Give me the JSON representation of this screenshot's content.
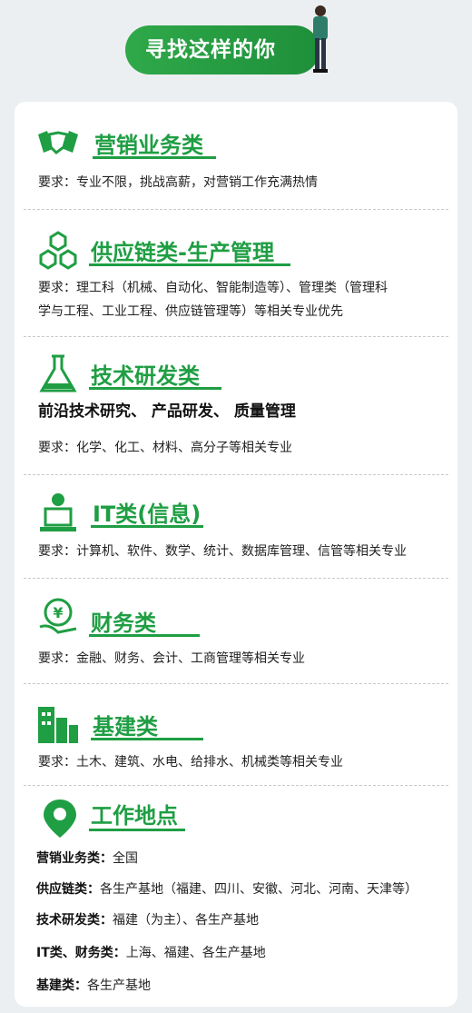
{
  "banner": {
    "title": "寻找这样的你"
  },
  "sections": [
    {
      "title": "营销业务类",
      "requirement": "要求：专业不限，挑战高薪，对营销工作充满热情",
      "icon": "handshake-icon"
    },
    {
      "title": "供应链类-生产管理",
      "requirement_line1": "要求：理工科（机械、自动化、智能制造等）、管理类（管理科",
      "requirement_line2": "学与工程、工业工程、供应链管理等）等相关专业优先",
      "icon": "cubes-icon"
    },
    {
      "title": "技术研发类",
      "focus": "前沿技术研究、 产品研发、 质量管理",
      "requirement": "要求：化学、化工、材料、高分子等相关专业",
      "icon": "flask-icon"
    },
    {
      "title": "IT类(信息)",
      "requirement": "要求：计算机、软件、数学、统计、数据库管理、信管等相关专业",
      "icon": "computer-user-icon"
    },
    {
      "title": "财务类",
      "requirement": "要求：金融、财务、会计、工商管理等相关专业",
      "icon": "yen-hand-icon"
    },
    {
      "title": "基建类",
      "requirement": "要求：土木、建筑、水电、给排水、机械类等相关专业",
      "icon": "buildings-icon"
    },
    {
      "title": "工作地点",
      "icon": "location-pin-icon"
    }
  ],
  "locations": [
    {
      "label": "营销业务类：",
      "value": "全国"
    },
    {
      "label": "供应链类：",
      "value": "各生产基地（福建、四川、安徽、河北、河南、天津等）"
    },
    {
      "label": "技术研发类：",
      "value": "福建（为主）、各生产基地"
    },
    {
      "label": "IT类、财务类：",
      "value": "上海、福建、各生产基地"
    },
    {
      "label": "基建类：",
      "value": "各生产基地"
    }
  ],
  "colors": {
    "accent": "#1f9e43",
    "background": "#eceff1",
    "card": "#ffffff"
  }
}
